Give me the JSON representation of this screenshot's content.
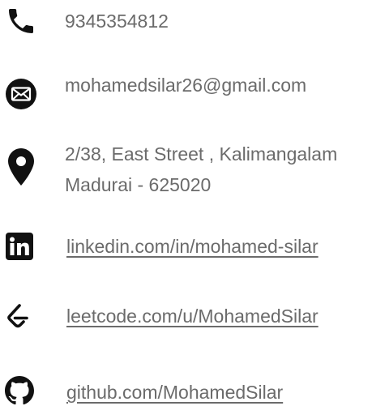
{
  "contact": {
    "phone": {
      "icon": "phone-icon",
      "text": "9345354812"
    },
    "email": {
      "icon": "envelope-icon",
      "text": "mohamedsilar26@gmail.com"
    },
    "address": {
      "icon": "location-pin-icon",
      "line1": "2/38, East Street , Kalimangalam",
      "line2": "Madurai - 625020"
    },
    "linkedin": {
      "icon": "linkedin-icon",
      "text": "linkedin.com/in/mohamed-silar"
    },
    "leetcode": {
      "icon": "leetcode-icon",
      "text": "leetcode.com/u/MohamedSilar"
    },
    "github": {
      "icon": "github-icon",
      "text": "github.com/MohamedSilar"
    }
  },
  "colors": {
    "text": "#6b6b6b",
    "icon": "#111111"
  }
}
